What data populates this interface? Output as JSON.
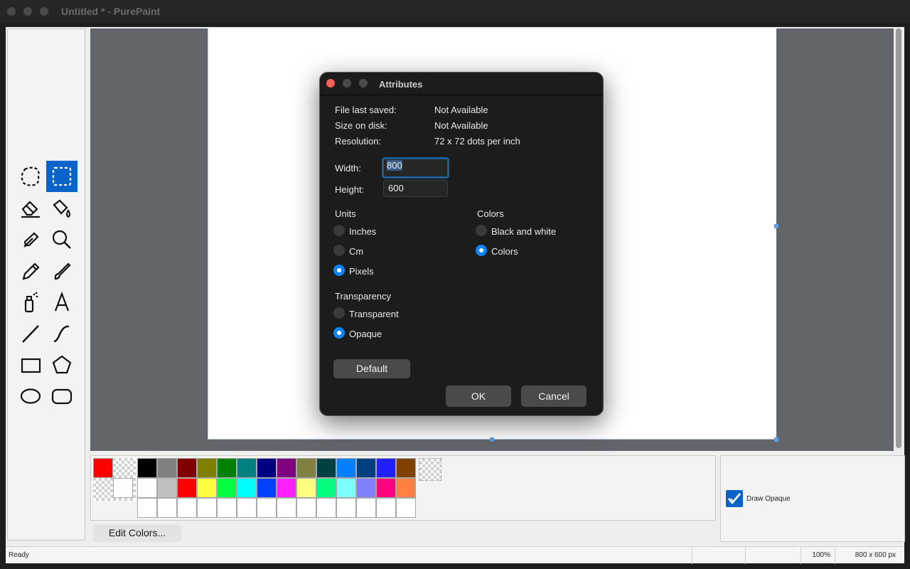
{
  "window": {
    "title": "Untitled * - PurePaint"
  },
  "toolbox": {
    "tools": [
      {
        "name": "free-form-select-icon",
        "selected": false
      },
      {
        "name": "rectangle-select-icon",
        "selected": true
      },
      {
        "name": "eraser-icon",
        "selected": false
      },
      {
        "name": "fill-bucket-icon",
        "selected": false
      },
      {
        "name": "color-picker-icon",
        "selected": false
      },
      {
        "name": "magnifier-icon",
        "selected": false
      },
      {
        "name": "pencil-icon",
        "selected": false
      },
      {
        "name": "brush-icon",
        "selected": false
      },
      {
        "name": "airbrush-icon",
        "selected": false
      },
      {
        "name": "text-icon",
        "selected": false
      },
      {
        "name": "line-icon",
        "selected": false
      },
      {
        "name": "curve-icon",
        "selected": false
      },
      {
        "name": "rectangle-icon",
        "selected": false
      },
      {
        "name": "polygon-icon",
        "selected": false
      },
      {
        "name": "ellipse-icon",
        "selected": false
      },
      {
        "name": "rounded-rectangle-icon",
        "selected": false
      }
    ]
  },
  "dialog": {
    "title": "Attributes",
    "info": [
      {
        "label": "File last saved:",
        "value": "Not Available"
      },
      {
        "label": "Size on disk:",
        "value": "Not Available"
      },
      {
        "label": "Resolution:",
        "value": "72 x 72 dots per inch"
      }
    ],
    "width_label": "Width:",
    "width_value": "800",
    "height_label": "Height:",
    "height_value": "600",
    "units": {
      "title": "Units",
      "options": [
        {
          "label": "Inches",
          "selected": false
        },
        {
          "label": "Cm",
          "selected": false
        },
        {
          "label": "Pixels",
          "selected": true
        }
      ]
    },
    "colors": {
      "title": "Colors",
      "options": [
        {
          "label": "Black and white",
          "selected": false
        },
        {
          "label": "Colors",
          "selected": true
        }
      ]
    },
    "transparency": {
      "title": "Transparency",
      "options": [
        {
          "label": "Transparent",
          "selected": false
        },
        {
          "label": "Opaque",
          "selected": true
        }
      ]
    },
    "default_label": "Default",
    "ok_label": "OK",
    "cancel_label": "Cancel"
  },
  "palette": {
    "primary_color": "#ff0000",
    "secondary_color": "#ffffff",
    "row1": [
      "#000000",
      "#808080",
      "#800000",
      "#808000",
      "#008000",
      "#008080",
      "#000080",
      "#800080",
      "#808040",
      "#004040",
      "#0080ff",
      "#004080",
      "#2020ff",
      "#804000"
    ],
    "row2": [
      "#ffffff",
      "#c0c0c0",
      "#ff0000",
      "#ffff40",
      "#00ff40",
      "#00ffff",
      "#0040ff",
      "#ff20ff",
      "#ffff80",
      "#00ff80",
      "#80ffff",
      "#8080ff",
      "#ff0080",
      "#ff8040"
    ],
    "row3_custom_count": 14,
    "edit_colors_label": "Edit Colors..."
  },
  "options": {
    "draw_opaque_label": "Draw Opaque",
    "draw_opaque_checked": true
  },
  "status": {
    "text": "Ready",
    "zoom": "100%",
    "size": "800 x 600 px"
  }
}
